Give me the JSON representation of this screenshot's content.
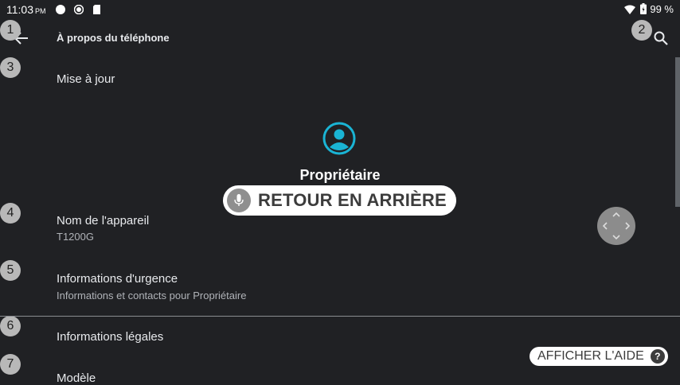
{
  "status_bar": {
    "time": "11:03",
    "time_suffix": "PM",
    "battery": "99 %"
  },
  "toolbar": {
    "title": "À propos du téléphone"
  },
  "markers": [
    "1",
    "2",
    "3",
    "4",
    "5",
    "6",
    "7"
  ],
  "items": [
    {
      "title": "Mise à jour"
    },
    {
      "title": "Nom de l'appareil",
      "subtitle": "T1200G"
    },
    {
      "title": "Informations d'urgence",
      "subtitle": "Informations et contacts pour Propriétaire"
    },
    {
      "title": "Informations légales"
    },
    {
      "title": "Modèle"
    }
  ],
  "owner": {
    "name": "Propriétaire"
  },
  "voice_overlay": {
    "label": "RETOUR EN ARRIÈRE"
  },
  "help": {
    "label": "AFFICHER L'AIDE",
    "icon_text": "?"
  },
  "colors": {
    "background": "#202124",
    "accent": "#1ab4d4"
  }
}
